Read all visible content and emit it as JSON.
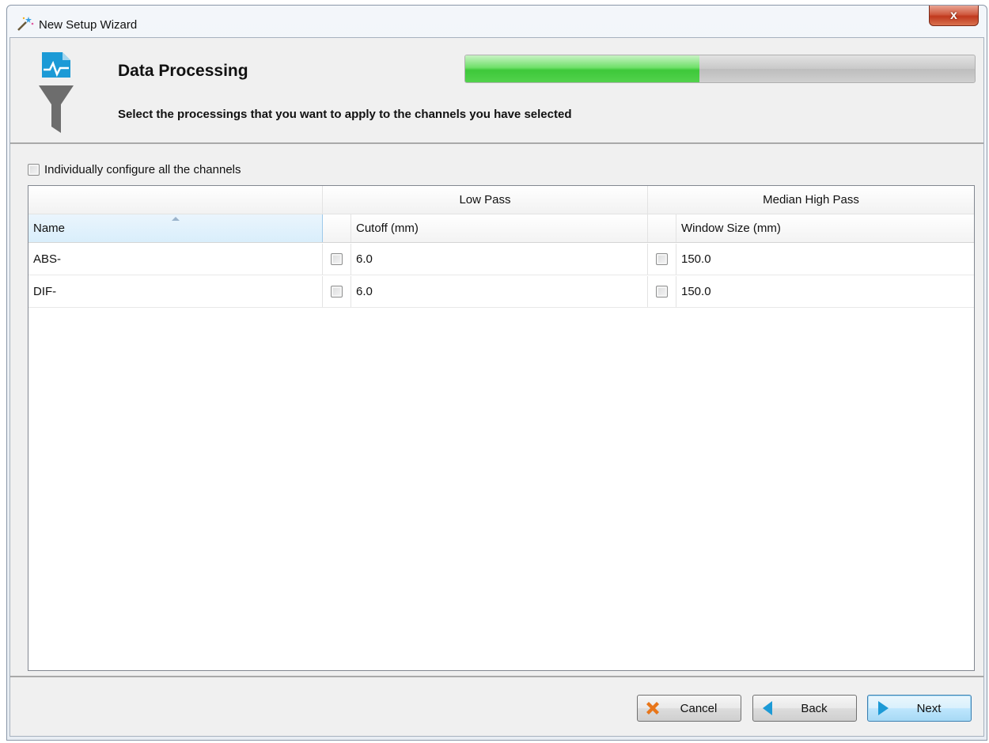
{
  "window": {
    "title": "New Setup Wizard",
    "close_label": "x"
  },
  "header": {
    "title": "Data Processing",
    "subtitle": "Select the processings that you want to apply to the channels you have selected",
    "progress_fraction": 0.46
  },
  "options": {
    "individually_configure_label": "Individually configure all the channels",
    "individually_configure_checked": false
  },
  "grid": {
    "groups": {
      "low_pass": "Low Pass",
      "median_high_pass": "Median High Pass"
    },
    "columns": {
      "name": "Name",
      "cutoff": "Cutoff (mm)",
      "window_size": "Window Size (mm)"
    },
    "rows": [
      {
        "name": "ABS-",
        "low_pass_enabled": false,
        "cutoff": "6.0",
        "median_enabled": false,
        "window_size": "150.0"
      },
      {
        "name": "DIF-",
        "low_pass_enabled": false,
        "cutoff": "6.0",
        "median_enabled": false,
        "window_size": "150.0"
      }
    ]
  },
  "footer": {
    "cancel_label": "Cancel",
    "back_label": "Back",
    "next_label": "Next"
  },
  "colors": {
    "progress": "#4cd046",
    "accent_blue": "#1c9ad6",
    "cancel_orange": "#e8761a"
  },
  "icons": {
    "title": "magic-wand-icon",
    "header": "data-filter-icon",
    "cancel": "x-icon",
    "back": "triangle-left-icon",
    "next": "triangle-right-icon"
  }
}
